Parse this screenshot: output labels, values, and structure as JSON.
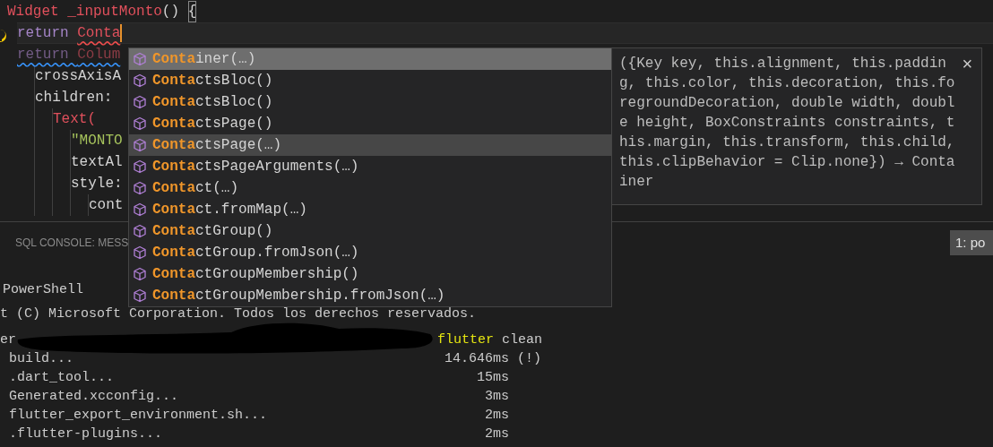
{
  "editor": {
    "lines": [
      {
        "current": false,
        "tokens": [
          {
            "text": "Widget _inputMonto",
            "kind": "type"
          },
          {
            "text": "() ",
            "kind": "plain"
          },
          {
            "text": "{",
            "kind": "bracket-match"
          }
        ],
        "children": [
          {
            "current": true,
            "tokens": [
              {
                "text": "return ",
                "kind": "keyword"
              },
              {
                "text": "Conta",
                "kind": "type",
                "error": true
              }
            ]
          },
          {
            "current": false,
            "tokens": [
              {
                "text": "return ",
                "kind": "keyword-faded",
                "info": true
              },
              {
                "text": "Colum",
                "kind": "type-faded",
                "info": true
              }
            ],
            "children": [
              {
                "current": false,
                "tokens": [
                  {
                    "text": "crossAxisA",
                    "kind": "plain"
                  }
                ]
              },
              {
                "current": false,
                "tokens": [
                  {
                    "text": "children:",
                    "kind": "plain"
                  }
                ],
                "children": [
                  {
                    "current": false,
                    "tokens": [
                      {
                        "text": "Text(",
                        "kind": "type"
                      }
                    ],
                    "children": [
                      {
                        "current": false,
                        "tokens": [
                          {
                            "text": "\"MONTO",
                            "kind": "string"
                          }
                        ]
                      },
                      {
                        "current": false,
                        "tokens": [
                          {
                            "text": "textAl",
                            "kind": "plain"
                          }
                        ]
                      },
                      {
                        "current": false,
                        "tokens": [
                          {
                            "text": "style:",
                            "kind": "plain"
                          }
                        ],
                        "children": [
                          {
                            "current": false,
                            "tokens": [
                              {
                                "text": "cont",
                                "kind": "plain"
                              }
                            ]
                          }
                        ]
                      }
                    ]
                  }
                ]
              }
            ]
          }
        ]
      }
    ]
  },
  "suggestions": {
    "items": [
      {
        "match": "Conta",
        "rest": "iner(…)",
        "selected": true,
        "hovered": false
      },
      {
        "match": "Conta",
        "rest": "ctsBloc()",
        "selected": false,
        "hovered": false
      },
      {
        "match": "Conta",
        "rest": "ctsBloc()",
        "selected": false,
        "hovered": false
      },
      {
        "match": "Conta",
        "rest": "ctsPage()",
        "selected": false,
        "hovered": false
      },
      {
        "match": "Conta",
        "rest": "ctsPage(…)",
        "selected": false,
        "hovered": true
      },
      {
        "match": "Conta",
        "rest": "ctsPageArguments(…)",
        "selected": false,
        "hovered": false
      },
      {
        "match": "Conta",
        "rest": "ct(…)",
        "selected": false,
        "hovered": false
      },
      {
        "match": "Conta",
        "rest": "ct.fromMap(…)",
        "selected": false,
        "hovered": false
      },
      {
        "match": "Conta",
        "rest": "ctGroup()",
        "selected": false,
        "hovered": false
      },
      {
        "match": "Conta",
        "rest": "ctGroup.fromJson(…)",
        "selected": false,
        "hovered": false
      },
      {
        "match": "Conta",
        "rest": "ctGroupMembership()",
        "selected": false,
        "hovered": false
      },
      {
        "match": "Conta",
        "rest": "ctGroupMembership.fromJson(…)",
        "selected": false,
        "hovered": false
      }
    ],
    "detail": {
      "signature": "({Key key, this.alignment, this.padding, this.color, this.decoration, this.foregroundDecoration, double width, double height, BoxConstraints constraints, this.margin, this.transform, this.child, this.clipBehavior = Clip.none}) → Container",
      "close": "×"
    }
  },
  "panel": {
    "title": "SQL CONSOLE: MESS",
    "terminal_tab": "1: po",
    "lines": [
      {
        "kind": "text",
        "text": "PowerShell"
      },
      {
        "kind": "text",
        "text": "t (C) Microsoft Corporation. Todos los derechos reservados."
      },
      {
        "kind": "command",
        "prompt": "er",
        "redacted": true,
        "program": "flutter",
        "args": "clean"
      },
      {
        "kind": "step",
        "label": "build...",
        "time": "14.646ms",
        "note": "(!)"
      },
      {
        "kind": "step",
        "label": ".dart_tool...",
        "time": "15ms"
      },
      {
        "kind": "step",
        "label": "Generated.xcconfig...",
        "time": "3ms"
      },
      {
        "kind": "step",
        "label": "flutter_export_environment.sh...",
        "time": "2ms"
      },
      {
        "kind": "step",
        "label": ".flutter-plugins...",
        "time": "2ms"
      }
    ]
  }
}
